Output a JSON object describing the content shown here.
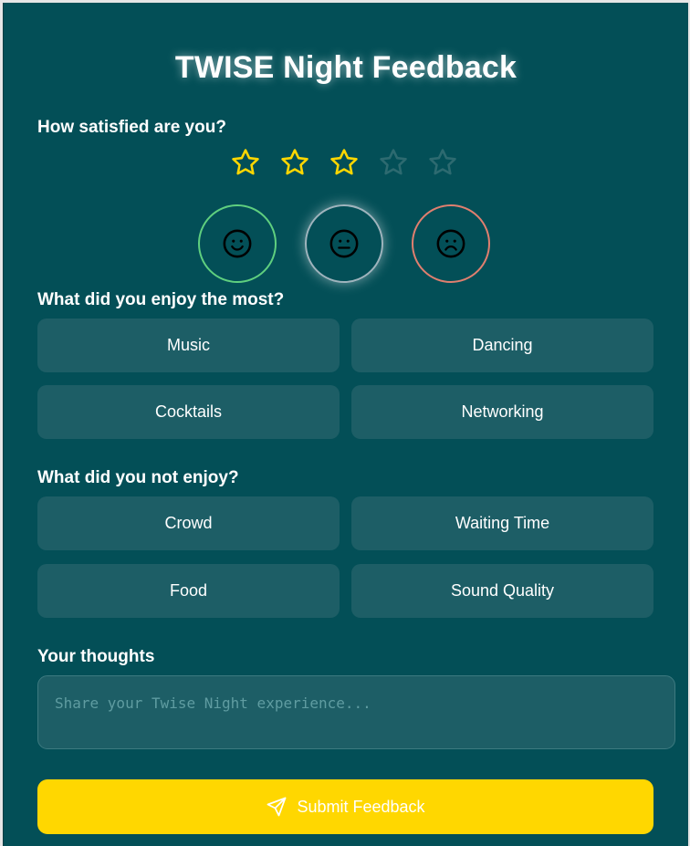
{
  "title": "TWISE Night Feedback",
  "rating": {
    "label": "How satisfied are you?",
    "value": 3,
    "max": 5,
    "filled_color": "#ffd700",
    "empty_color": "#2d6a70"
  },
  "moods": [
    {
      "name": "happy",
      "icon": "smile-face-icon",
      "color": "#5fcf7f"
    },
    {
      "name": "neutral",
      "icon": "neutral-face-icon",
      "color": "#9fb4bd",
      "selected": true
    },
    {
      "name": "sad",
      "icon": "frown-face-icon",
      "color": "#e07f6f"
    }
  ],
  "enjoy": {
    "label": "What did you enjoy the most?",
    "options": [
      "Music",
      "Dancing",
      "Cocktails",
      "Networking"
    ]
  },
  "not_enjoy": {
    "label": "What did you not enjoy?",
    "options": [
      "Crowd",
      "Waiting Time",
      "Food",
      "Sound Quality"
    ]
  },
  "thoughts": {
    "label": "Your thoughts",
    "placeholder": "Share your Twise Night experience..."
  },
  "submit": {
    "label": "Submit Feedback",
    "icon": "send-icon",
    "color": "#ffd700"
  }
}
